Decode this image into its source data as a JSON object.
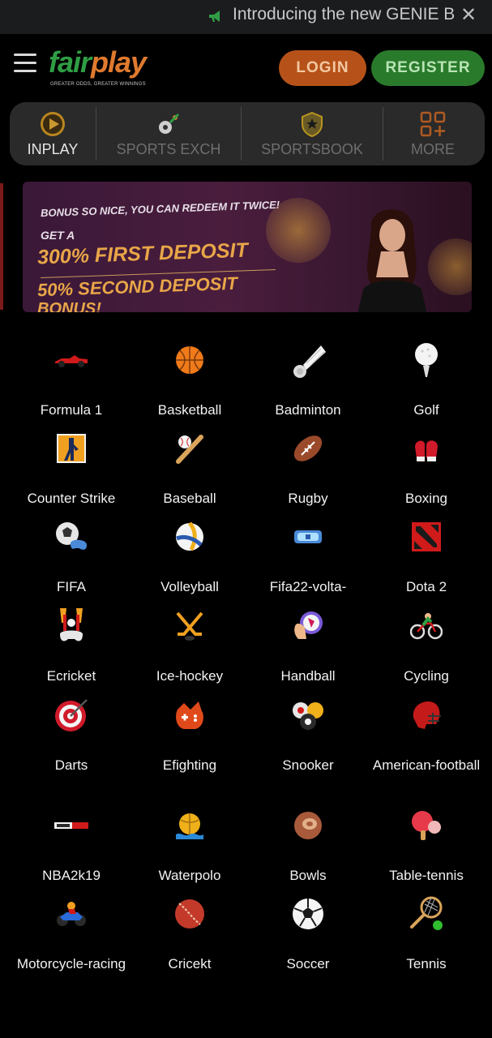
{
  "announcement": {
    "text": "Introducing the new GENIE B",
    "close": "✕"
  },
  "header": {
    "logo_fair": "fair",
    "logo_play": "play",
    "logo_tagline": "GREATER ODDS, GREATER WINNINGS",
    "login_label": "LOGIN",
    "register_label": "REGISTER"
  },
  "categories": [
    {
      "label": "INPLAY",
      "icon": "play-icon",
      "active": true
    },
    {
      "label": "SPORTS EXCH",
      "icon": "sports-exchange-icon",
      "active": false
    },
    {
      "label": "SPORTSBOOK",
      "icon": "shield-star-icon",
      "active": false
    },
    {
      "label": "MORE",
      "icon": "grid-plus-icon",
      "active": false
    }
  ],
  "banner": {
    "line1": "BONUS SO NICE, YOU CAN REDEEM IT TWICE!",
    "line2": "GET A",
    "line3": "300% FIRST DEPOSIT",
    "line4": "50% SECOND DEPOSIT",
    "line5": "BONUS!"
  },
  "sports": [
    {
      "name": "Formula 1",
      "icon": "race-car-icon"
    },
    {
      "name": "Basketball",
      "icon": "basketball-icon"
    },
    {
      "name": "Badminton",
      "icon": "shuttlecock-icon"
    },
    {
      "name": "Golf",
      "icon": "golf-ball-icon"
    },
    {
      "name": "Counter Strike",
      "icon": "counter-strike-icon"
    },
    {
      "name": "Baseball",
      "icon": "baseball-icon"
    },
    {
      "name": "Rugby",
      "icon": "rugby-ball-icon"
    },
    {
      "name": "Boxing",
      "icon": "boxing-glove-icon"
    },
    {
      "name": "FIFA",
      "icon": "fifa-controller-icon"
    },
    {
      "name": "Volleyball",
      "icon": "volleyball-icon"
    },
    {
      "name": "Fifa22-volta-",
      "icon": "vr-headset-icon"
    },
    {
      "name": "Dota 2",
      "icon": "dota-icon"
    },
    {
      "name": "Ecricket",
      "icon": "ecricket-icon"
    },
    {
      "name": "Ice-hockey",
      "icon": "hockey-sticks-icon"
    },
    {
      "name": "Handball",
      "icon": "handball-icon"
    },
    {
      "name": "Cycling",
      "icon": "cyclist-icon"
    },
    {
      "name": "Darts",
      "icon": "dartboard-icon"
    },
    {
      "name": "Efighting",
      "icon": "efighting-icon"
    },
    {
      "name": "Snooker",
      "icon": "billiard-balls-icon"
    },
    {
      "name": "American-football",
      "icon": "football-helmet-icon"
    },
    {
      "name": "NBA2k19",
      "icon": "nba2k-icon"
    },
    {
      "name": "Waterpolo",
      "icon": "waterpolo-icon"
    },
    {
      "name": "Bowls",
      "icon": "bowls-icon"
    },
    {
      "name": "Table-tennis",
      "icon": "ping-pong-icon"
    },
    {
      "name": "Motorcycle-racing",
      "icon": "motorcycle-icon"
    },
    {
      "name": "Cricekt",
      "icon": "cricket-ball-icon"
    },
    {
      "name": "Soccer",
      "icon": "soccer-ball-icon"
    },
    {
      "name": "Tennis",
      "icon": "tennis-racket-icon"
    }
  ]
}
